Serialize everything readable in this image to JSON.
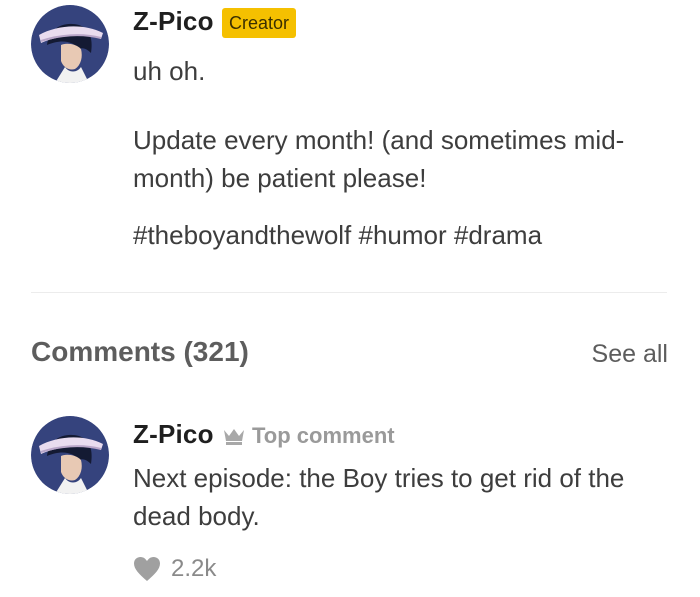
{
  "creator_note": {
    "author": "Z-Pico",
    "badge": "Creator",
    "line1": "uh oh.",
    "line2": "Update every month! (and sometimes mid-month) be patient please!",
    "tags": "#theboyandthewolf #humor #drama",
    "avatar_icon": "user-avatar-icon"
  },
  "comments": {
    "title": "Comments (321)",
    "see_all": "See all",
    "items": [
      {
        "author": "Z-Pico",
        "tag": "Top comment",
        "tag_icon": "crown-icon",
        "text": "Next episode: the Boy tries to get rid of the dead body.",
        "likes": "2.2k",
        "like_icon": "heart-icon"
      }
    ]
  },
  "colors": {
    "badge": "#f5c000",
    "text_primary": "#1f1f1f",
    "text_secondary": "#3d3d3d",
    "muted": "#9a9a9a",
    "avatar_bg": "#3b4a86"
  }
}
